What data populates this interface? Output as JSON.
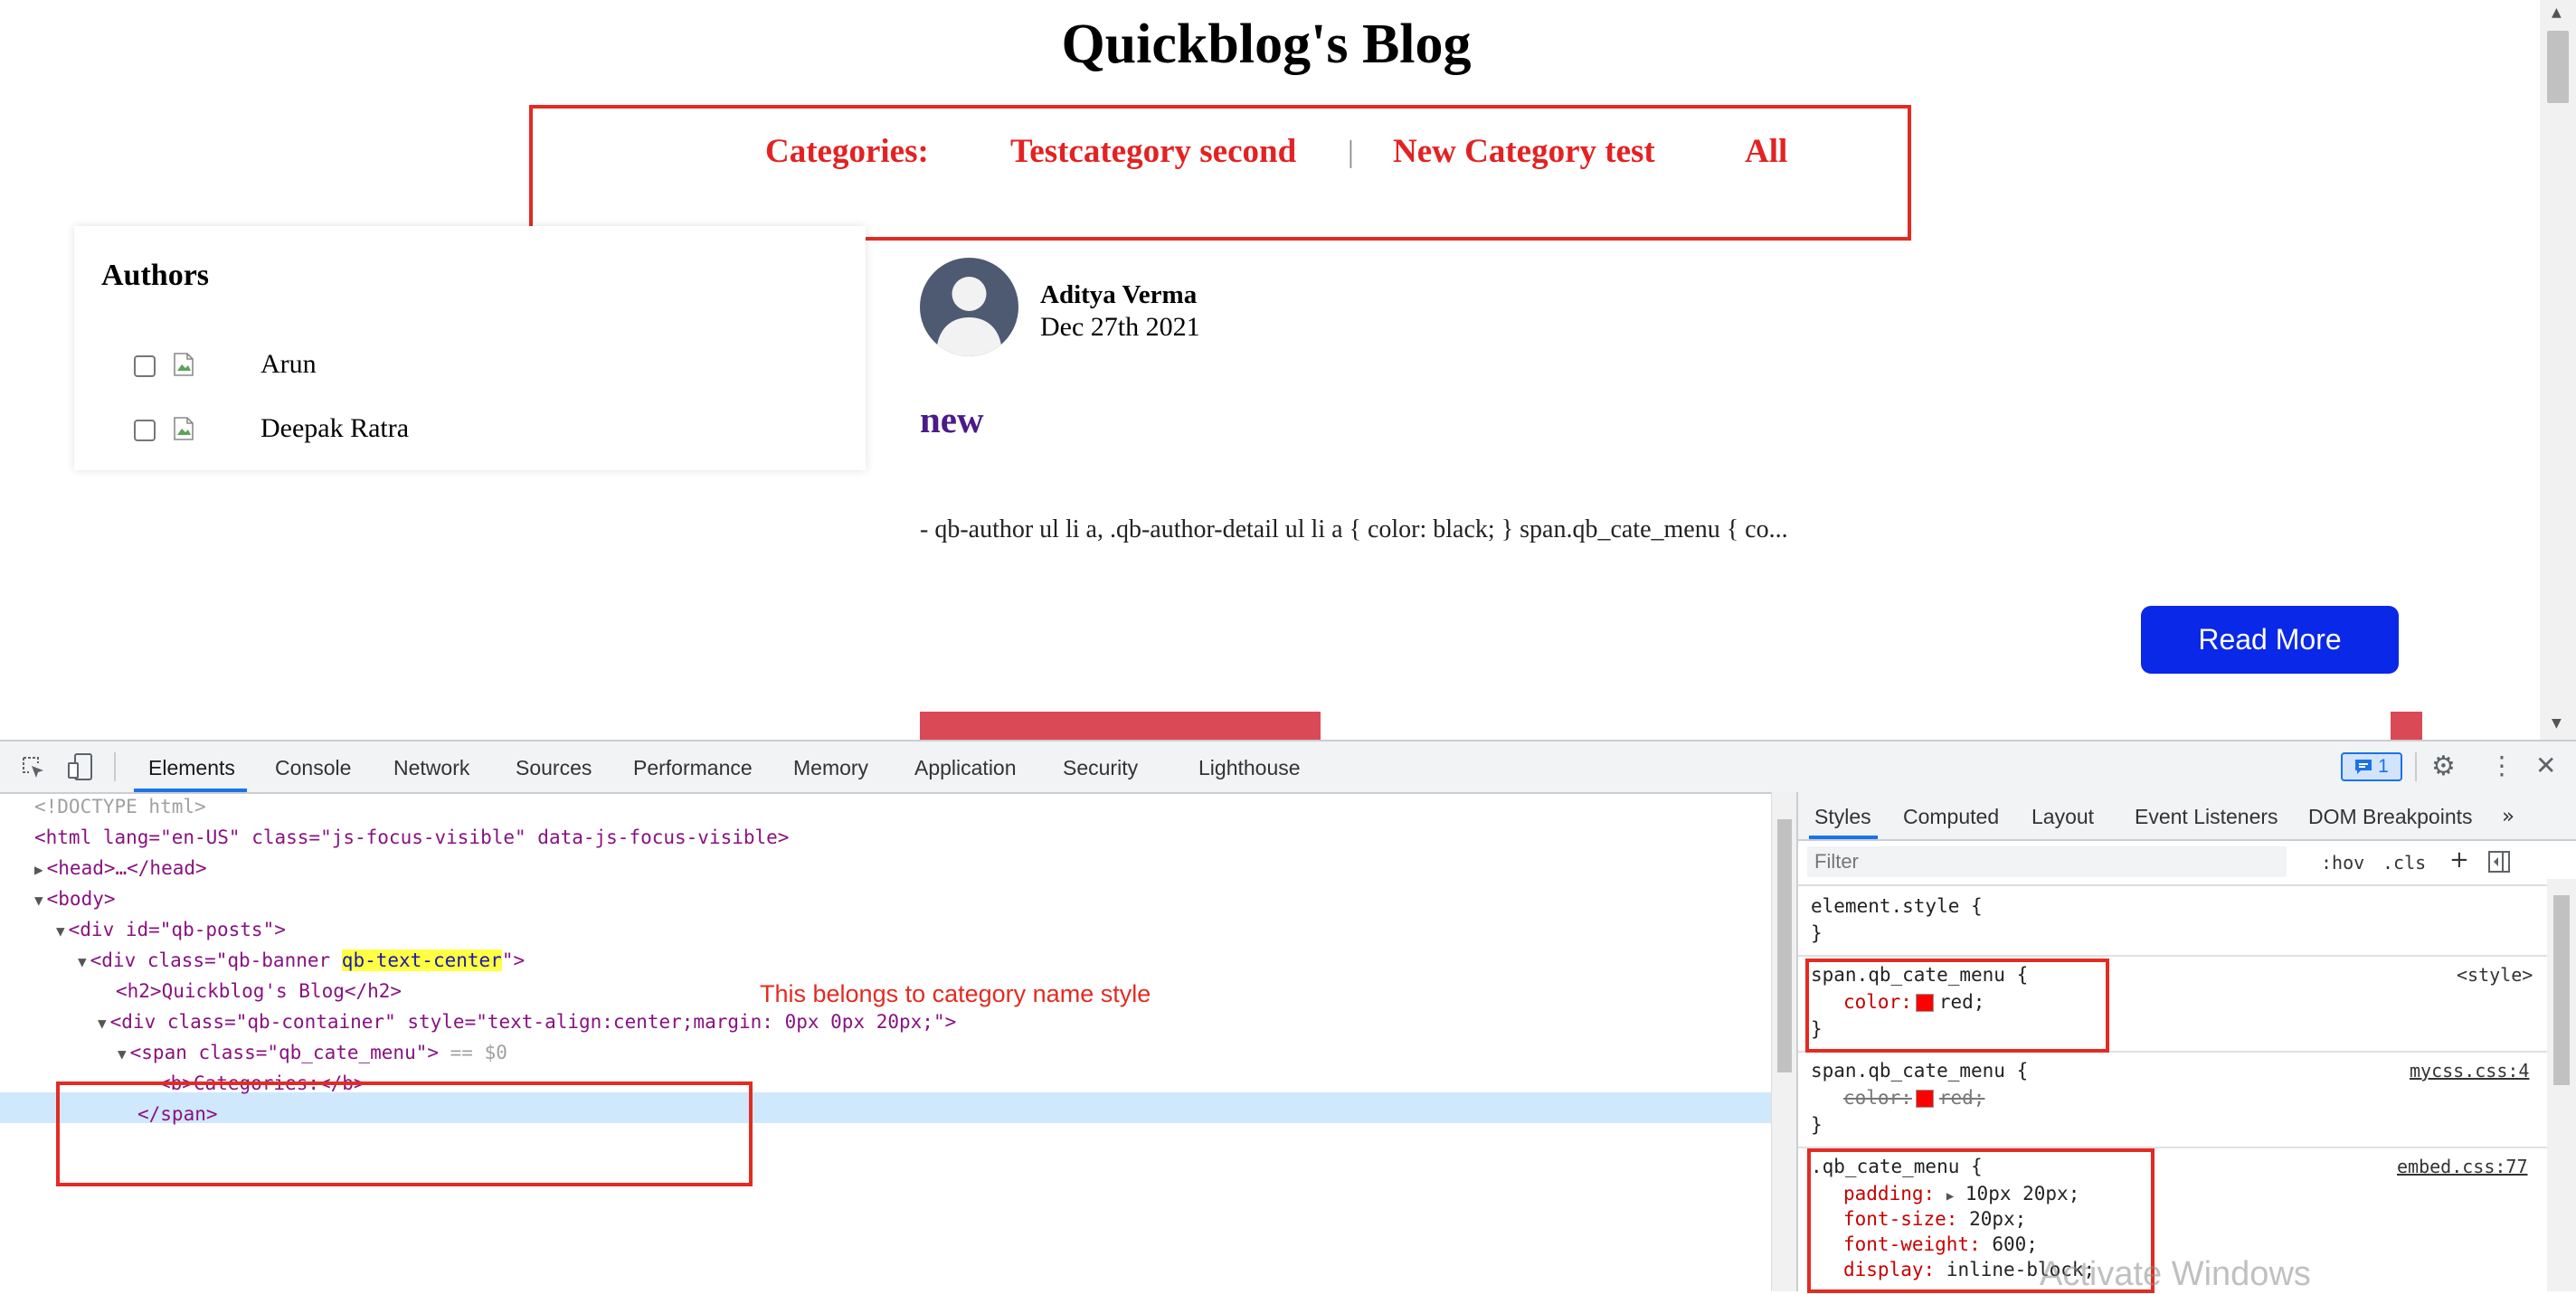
{
  "blog": {
    "title": "Quickblog's Blog",
    "categories_label": "Categories:",
    "categories": [
      "Testcategory second",
      "New Category test",
      "All"
    ],
    "category_separator": "|",
    "authors_title": "Authors",
    "authors": [
      "Arun",
      "Deepak Ratra"
    ],
    "post": {
      "author": "Aditya Verma",
      "date": "Dec 27th 2021",
      "title": "new",
      "excerpt": "- qb-author ul li a, .qb-author-detail ul li a { color: black; } span.qb_cate_menu { co...",
      "read_more": "Read More"
    }
  },
  "devtools": {
    "tabs": [
      "Elements",
      "Console",
      "Network",
      "Sources",
      "Performance",
      "Memory",
      "Application",
      "Security",
      "Lighthouse"
    ],
    "active_tab": "Elements",
    "issues_count": "1",
    "dom": {
      "doctype": "<!DOCTYPE html>",
      "html_open": "<html lang=\"en-US\" class=\"js-focus-visible\" data-js-focus-visible>",
      "head": "<head>…</head>",
      "body": "<body>",
      "qb_posts": "<div id=\"qb-posts\">",
      "banner_pre": "<div class=\"qb-banner ",
      "banner_hl": "qb-text-center",
      "banner_post": "\">",
      "h2": "<h2>Quickblog's Blog</h2>",
      "container": "<div class=\"qb-container\" style=\"text-align:center;margin: 0px 0px 20px;\">",
      "span_open": "<span class=\"qb_cate_menu\">",
      "span_eq": " == $0",
      "b_line": "<b>Categories:</b>",
      "span_close": "</span>"
    },
    "annotation": "This belongs to category name style",
    "styles": {
      "tabs": [
        "Styles",
        "Computed",
        "Layout",
        "Event Listeners",
        "DOM Breakpoints"
      ],
      "filter_placeholder": "Filter",
      "hov": ":hov",
      "cls": ".cls",
      "element_style": "element.style {",
      "close_brace": "}",
      "rule1_selector": "span.qb_cate_menu {",
      "rule1_source": "<style>",
      "rule1_prop": "color:",
      "rule1_val": "red;",
      "rule2_selector": "span.qb_cate_menu {",
      "rule2_source": "mycss.css:4",
      "rule2_prop": "color:",
      "rule2_val": "red;",
      "rule3_selector": ".qb_cate_menu {",
      "rule3_source": "embed.css:77",
      "rule3_props": [
        {
          "prop": "padding:",
          "val": "10px 20px;"
        },
        {
          "prop": "font-size:",
          "val": "20px;"
        },
        {
          "prop": "font-weight:",
          "val": "600;"
        },
        {
          "prop": "display:",
          "val": "inline-block;"
        }
      ],
      "swatch_color": "#ff0000"
    }
  },
  "watermark": "Activate Windows"
}
